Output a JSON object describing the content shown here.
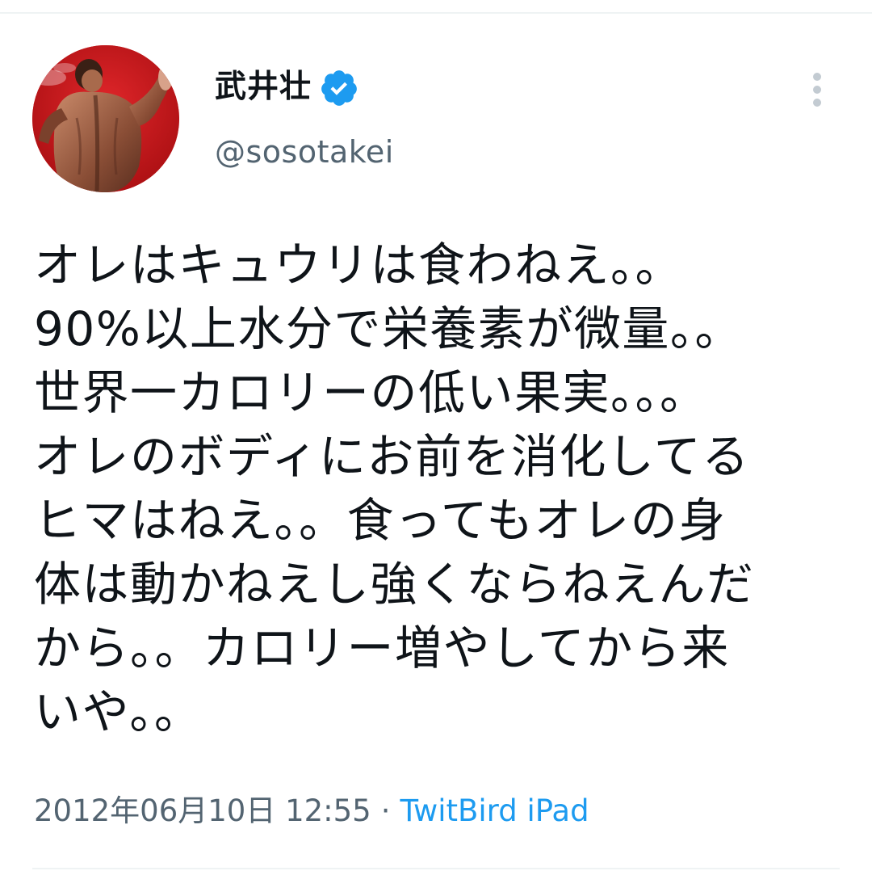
{
  "user": {
    "display_name": "武井壮",
    "handle": "@sosotakei",
    "verified": true,
    "avatar_description": "muscular back posing on red background"
  },
  "tweet": {
    "lines": [
      "オレはキュウリは食わねえ。。",
      "90%以上水分で栄養素が微量。。",
      "世界一カロリーの低い果実。。。",
      "オレのボディにお前を消化してる",
      "ヒマはねえ。。食ってもオレの身",
      "体は動かねえし強くならねえんだ",
      "から。。カロリー増やしてから来",
      "いや。。"
    ]
  },
  "meta": {
    "timestamp": "2012年06月10日 12:55",
    "separator": "·",
    "source": "TwitBird iPad"
  },
  "icons": {
    "verified": "verified-badge-icon",
    "more": "more-vertical-icon"
  },
  "colors": {
    "accent": "#1d9bf0",
    "secondary_text": "#536471",
    "avatar_bg": "#c81417"
  }
}
